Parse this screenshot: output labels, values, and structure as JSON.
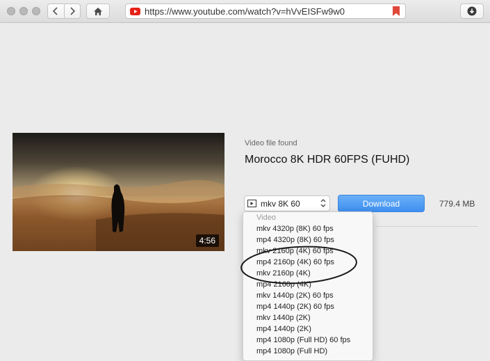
{
  "toolbar": {
    "url": "https://www.youtube.com/watch?v=hVvEISFw9w0",
    "icons": [
      "chevron-left-icon",
      "chevron-right-icon",
      "home-icon",
      "youtube-icon",
      "bookmark-icon",
      "download-arrow-icon"
    ]
  },
  "video": {
    "duration": "4:56",
    "found_label": "Video file found",
    "title": "Morocco 8K HDR 60FPS (FUHD)"
  },
  "format_select": {
    "value": "mkv 8K 60"
  },
  "download": {
    "label": "Download",
    "size": "779.4 MB"
  },
  "dropdown": {
    "header": "Video",
    "options": [
      "mkv 4320p (8K) 60 fps",
      "mp4 4320p (8K) 60 fps",
      "mkv 2160p (4K) 60 fps",
      "mp4 2160p (4K) 60 fps",
      "mkv 2160p (4K)",
      "mp4 2160p (4K)",
      "mkv 1440p (2K) 60 fps",
      "mp4 1440p (2K) 60 fps",
      "mkv 1440p (2K)",
      "mp4 1440p (2K)",
      "mp4 1080p (Full HD) 60 fps",
      "mp4 1080p (Full HD)"
    ]
  },
  "colors": {
    "accent": "#3f8ff0",
    "youtube_red": "#e62117",
    "bookmark_red": "#e0483a",
    "annotation": "#1a1a1a"
  }
}
